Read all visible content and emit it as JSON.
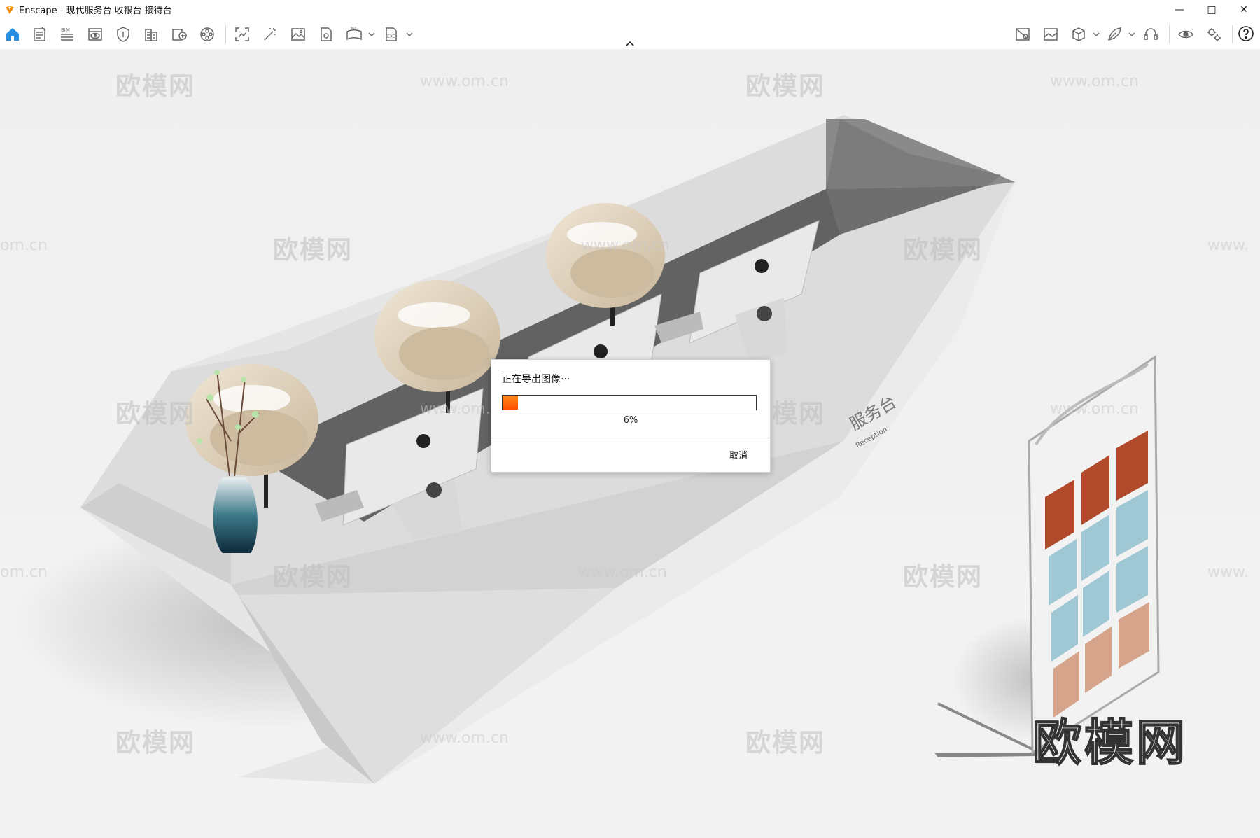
{
  "window": {
    "app_name": "Enscape",
    "title": "Enscape - 现代服务台 收银台 接待台",
    "accent_color": "#ff8a00"
  },
  "toolbar": {
    "icons": [
      "home-icon",
      "document-icon",
      "bim-icon",
      "visual-settings-icon",
      "shield-icon",
      "building-icon",
      "add-view-icon",
      "video-reel-icon",
      "screenshot-icon",
      "magic-wand-icon",
      "image-icon",
      "file-render-icon",
      "panorama-360-icon",
      "exe-export-icon",
      "asset-library-icon",
      "gallery-icon",
      "cube-icon",
      "feather-icon",
      "headset-icon",
      "eye-icon",
      "settings-gears-icon",
      "help-icon"
    ],
    "bim_label": "BIM",
    "pano_label": "360",
    "exe_label": "EXE"
  },
  "watermarks": {
    "brand": "欧模网",
    "site": "www.om.cn",
    "site_partial_left": "om.cn",
    "site_partial_right": "www."
  },
  "scene": {
    "sign_text": "服务台",
    "sign_subtext": "Reception"
  },
  "dialog": {
    "title": "正在导出图像···",
    "progress_percent": 6,
    "progress_label": "6%",
    "cancel_label": "取消"
  }
}
